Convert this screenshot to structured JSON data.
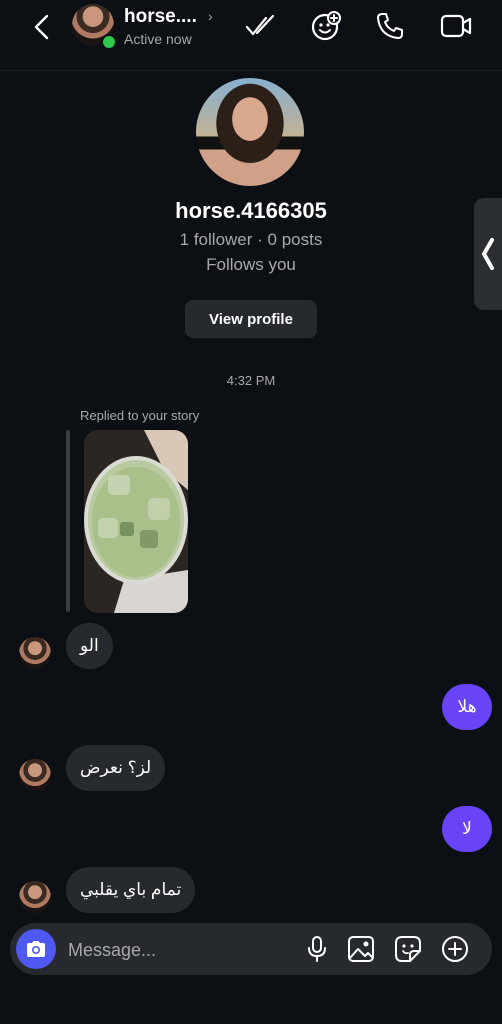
{
  "header": {
    "username": "horse....",
    "status": "Active now"
  },
  "profile": {
    "username": "horse.4166305",
    "stats": "1 follower · 0 posts",
    "follows": "Follows you",
    "view_profile_label": "View profile"
  },
  "thread": {
    "timestamp": "4:32 PM",
    "reply_label": "Replied to your story",
    "messages": [
      {
        "direction": "in",
        "text": "الو"
      },
      {
        "direction": "out",
        "text": "هلا"
      },
      {
        "direction": "in",
        "text": "لز؟ نعرض"
      },
      {
        "direction": "out",
        "text": "لا"
      },
      {
        "direction": "in",
        "text": "تمام باي يقلبي"
      }
    ]
  },
  "composer": {
    "placeholder": "Message..."
  },
  "icons": {
    "header": [
      "back-chevron-icon",
      "double-check-icon",
      "add-emoji-icon",
      "phone-icon",
      "video-icon"
    ],
    "composer": [
      "camera-icon",
      "microphone-icon",
      "gallery-icon",
      "sticker-icon",
      "plus-icon"
    ]
  },
  "colors": {
    "background": "#0c1014",
    "incoming_bubble": "#262a2e",
    "outgoing_bubble": "#6844f6",
    "camera_button": "#4f58f0",
    "online_dot": "#2dc84d"
  }
}
